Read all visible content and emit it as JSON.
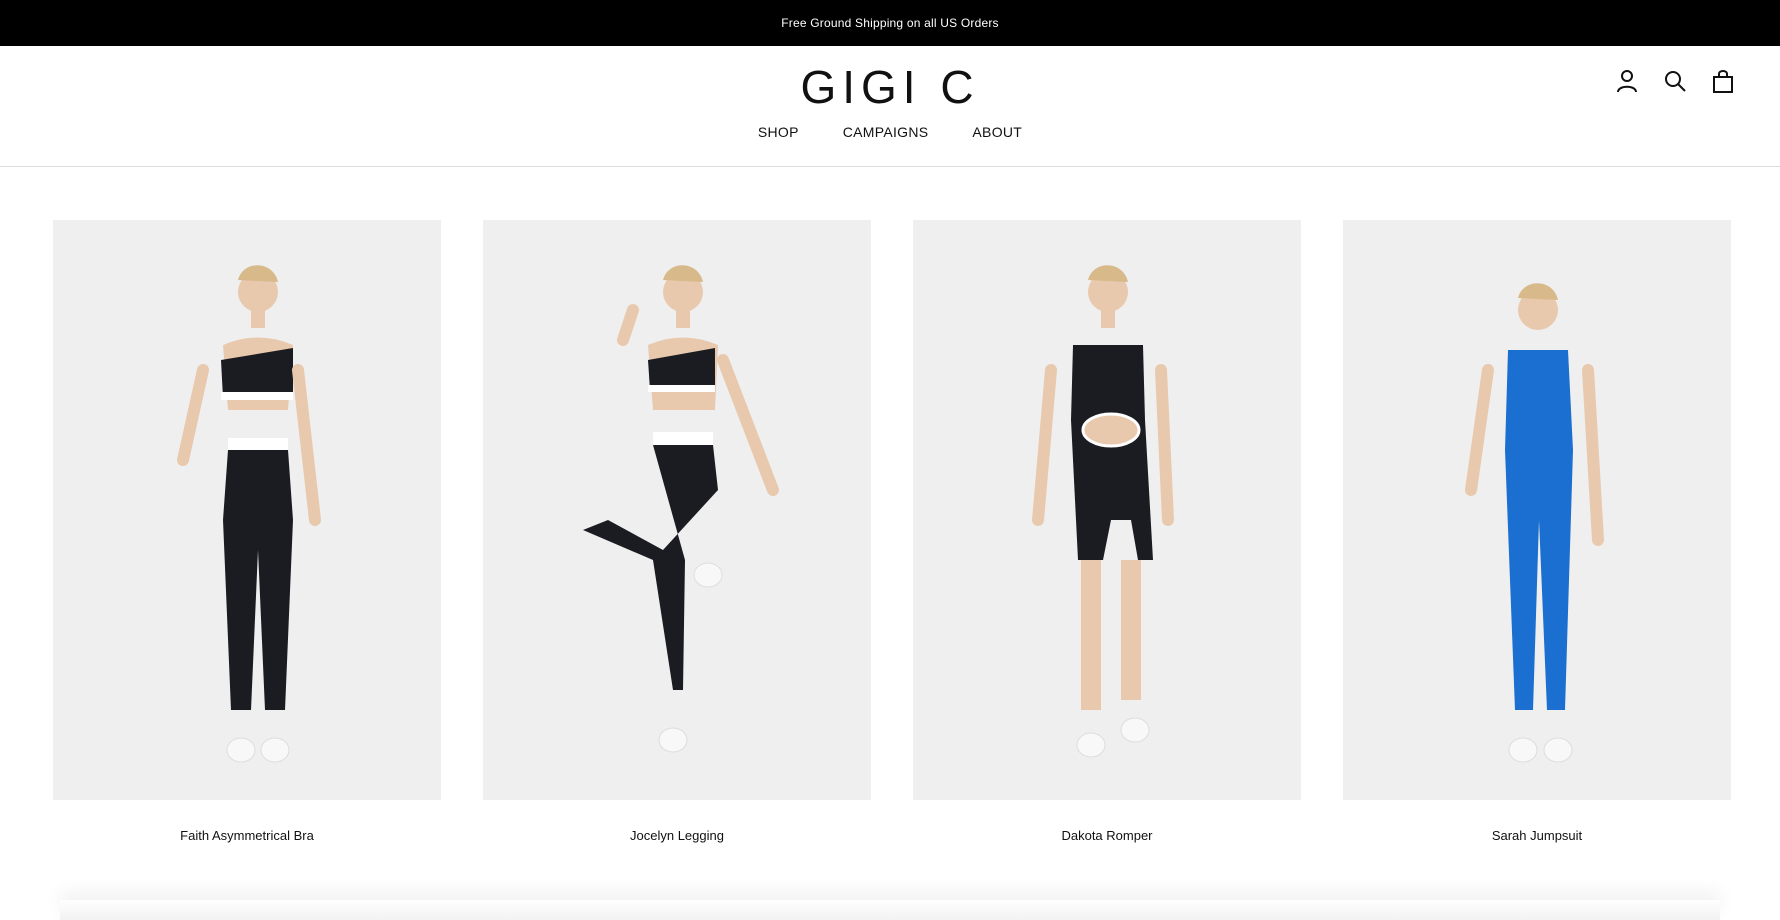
{
  "announcement": "Free Ground Shipping on all US Orders",
  "brand": {
    "logo": "GIGI C"
  },
  "nav": [
    {
      "label": "SHOP"
    },
    {
      "label": "CAMPAIGNS"
    },
    {
      "label": "ABOUT"
    }
  ],
  "header_icons": [
    "account-icon",
    "search-icon",
    "bag-icon"
  ],
  "products": [
    {
      "name": "Faith Asymmetrical Bra",
      "outfit_color": "#1b1c22"
    },
    {
      "name": "Jocelyn Legging",
      "outfit_color": "#1b1c22"
    },
    {
      "name": "Dakota Romper",
      "outfit_color": "#1b1c22"
    },
    {
      "name": "Sarah Jumpsuit",
      "outfit_color": "#1a6fd0"
    }
  ]
}
